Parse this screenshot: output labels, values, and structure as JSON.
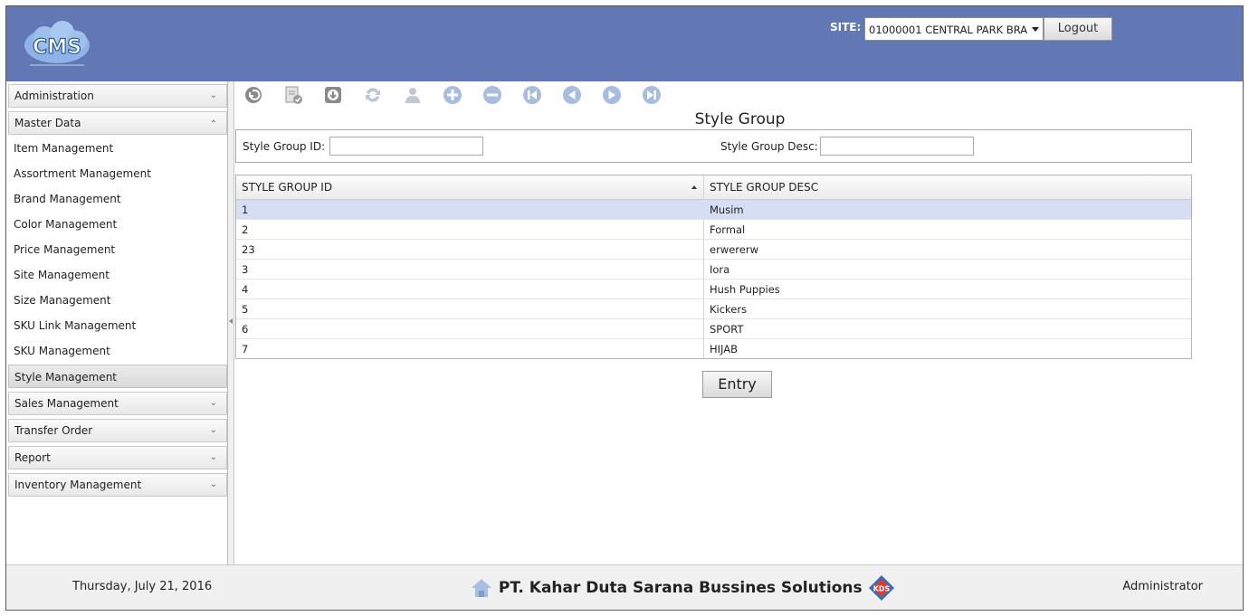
{
  "header": {
    "logo_text": "CMS",
    "site_label": "SITE:",
    "site_value": "01000001 CENTRAL PARK BRA",
    "logout_label": "Logout"
  },
  "sidebar": {
    "sections": [
      {
        "label": "Administration",
        "state": "collapsed"
      },
      {
        "label": "Master Data",
        "state": "expanded"
      }
    ],
    "items": [
      {
        "label": "Item Management"
      },
      {
        "label": "Assortment Management"
      },
      {
        "label": "Brand Management"
      },
      {
        "label": "Color Management"
      },
      {
        "label": "Price Management"
      },
      {
        "label": "Site Management"
      },
      {
        "label": "Size Management"
      },
      {
        "label": "SKU Link Management"
      },
      {
        "label": "SKU Management"
      },
      {
        "label": "Style Management"
      }
    ],
    "lower_sections": [
      {
        "label": "Sales Management"
      },
      {
        "label": "Transfer Order"
      },
      {
        "label": "Report"
      },
      {
        "label": "Inventory Management"
      }
    ]
  },
  "toolbar": {
    "icons": [
      "undo-icon",
      "approve-document-icon",
      "download-icon",
      "refresh-icon",
      "user-icon",
      "add-icon",
      "remove-icon",
      "first-record-icon",
      "previous-record-icon",
      "next-record-icon",
      "last-record-icon"
    ]
  },
  "page": {
    "title": "Style Group"
  },
  "filter": {
    "id_label": "Style Group ID:",
    "id_value": "",
    "desc_label": "Style Group Desc:",
    "desc_value": ""
  },
  "grid": {
    "columns": [
      "STYLE GROUP ID",
      "STYLE GROUP DESC"
    ],
    "rows": [
      {
        "id": "1",
        "desc": "Musim"
      },
      {
        "id": "2",
        "desc": "Formal"
      },
      {
        "id": "23",
        "desc": "erwererw"
      },
      {
        "id": "3",
        "desc": "Iora"
      },
      {
        "id": "4",
        "desc": "Hush Puppies"
      },
      {
        "id": "5",
        "desc": "Kickers"
      },
      {
        "id": "6",
        "desc": "SPORT"
      },
      {
        "id": "7",
        "desc": "HIJAB"
      }
    ]
  },
  "entry_label": "Entry",
  "footer": {
    "date": "Thursday, July 21, 2016",
    "company": "PT. Kahar Duta Sarana Bussines Solutions",
    "company_badge": "KDS",
    "user": "Administrator"
  },
  "colors": {
    "header_bg": "#6278b5",
    "icon_blue": "#9fb8dc",
    "icon_grey": "#8a8a8a",
    "selected_row": "#d5def3"
  }
}
